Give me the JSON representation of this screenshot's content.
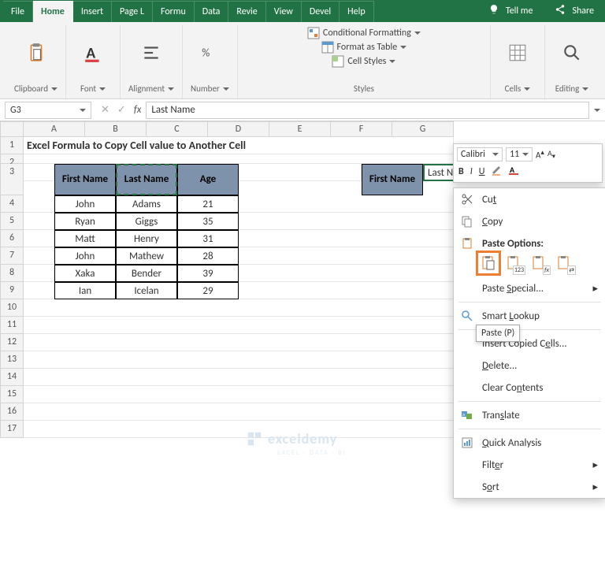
{
  "tabs": {
    "file": "File",
    "home": "Home",
    "insert": "Insert",
    "pagel": "Page L",
    "formu": "Formu",
    "data": "Data",
    "revie": "Revie",
    "view": "View",
    "devel": "Devel",
    "help": "Help",
    "tellme": "Tell me",
    "share": "Share"
  },
  "ribbon": {
    "clipboard": "Clipboard",
    "font": "Font",
    "alignment": "Alignment",
    "number": "Number",
    "styles": "Styles",
    "cells": "Cells",
    "editing": "Editing",
    "cond_fmt": "Conditional Formatting",
    "fmt_table": "Format as Table",
    "cell_styles": "Cell Styles"
  },
  "namebox": "G3",
  "formula_value": "Last Name",
  "title": "Excel Formula to Copy Cell value to Another Cell",
  "headers": {
    "first": "First Name",
    "last": "Last Name",
    "age": "Age"
  },
  "rows": [
    {
      "first": "John",
      "last": "Adams",
      "age": "21"
    },
    {
      "first": "Ryan",
      "last": "Giggs",
      "age": "35"
    },
    {
      "first": "Matt",
      "last": "Henry",
      "age": "31"
    },
    {
      "first": "John",
      "last": "Mathew",
      "age": "28"
    },
    {
      "first": "Xaka",
      "last": "Bender",
      "age": "39"
    },
    {
      "first": "Ian",
      "last": "Icelan",
      "age": "29"
    }
  ],
  "dest_header": "First Name",
  "dest_partial": "Last N",
  "mini": {
    "font": "Calibri",
    "size": "11",
    "bold": "B",
    "italic": "I"
  },
  "context": {
    "cut": "Cut",
    "copy": "Copy",
    "paste_options": "Paste Options:",
    "paste_special": "Paste Special...",
    "smart_lookup": "Smart Lookup",
    "insert_copied": "Insert Copied Cells...",
    "delete": "Delete...",
    "clear": "Clear Contents",
    "translate": "Translate",
    "quick": "Quick Analysis",
    "filter": "Filter",
    "sort": "Sort"
  },
  "tooltip": "Paste (P)",
  "cols": [
    "A",
    "B",
    "C",
    "D",
    "E",
    "F",
    "G"
  ],
  "rownums": [
    "1",
    "2",
    "3",
    "4",
    "5",
    "6",
    "7",
    "8",
    "9",
    "10",
    "11",
    "12",
    "13",
    "14",
    "15",
    "16",
    "17"
  ],
  "watermark": "exceldemy",
  "watermark_sub": "EXCEL · DATA · BI"
}
